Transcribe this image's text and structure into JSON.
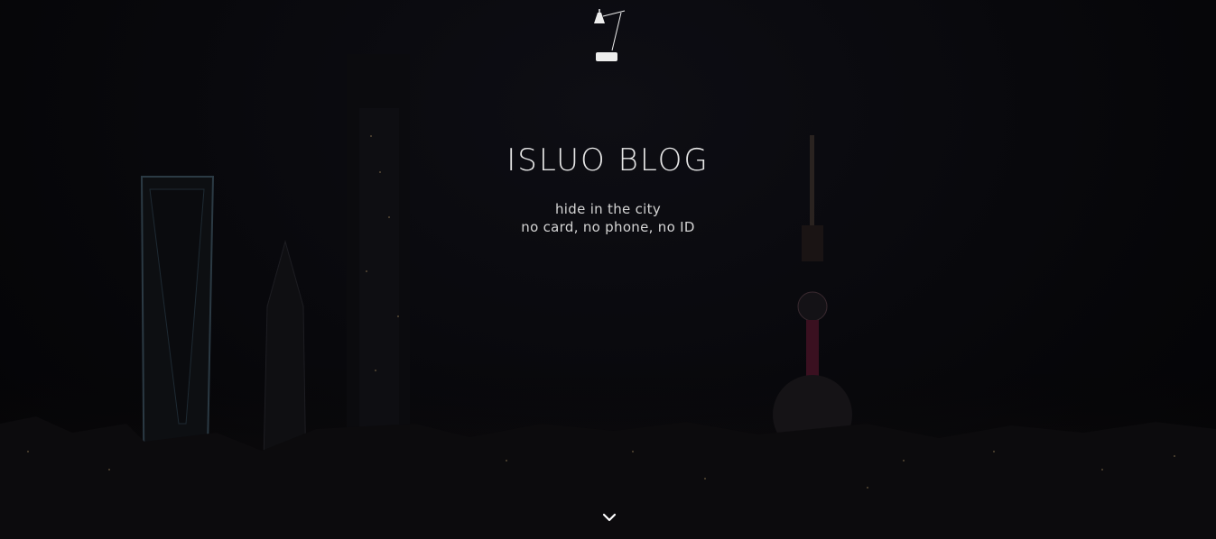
{
  "site": {
    "title": "ISLUO BLOG",
    "tagline_lines": [
      "hide in the city",
      "no card, no phone, no ID"
    ]
  },
  "icons": {
    "logo": "desk-lamp-icon",
    "scroll": "chevron-down-icon"
  },
  "colors": {
    "background": "#07070a",
    "text": "#e6e6e6",
    "accent_light": "#ffffff"
  }
}
